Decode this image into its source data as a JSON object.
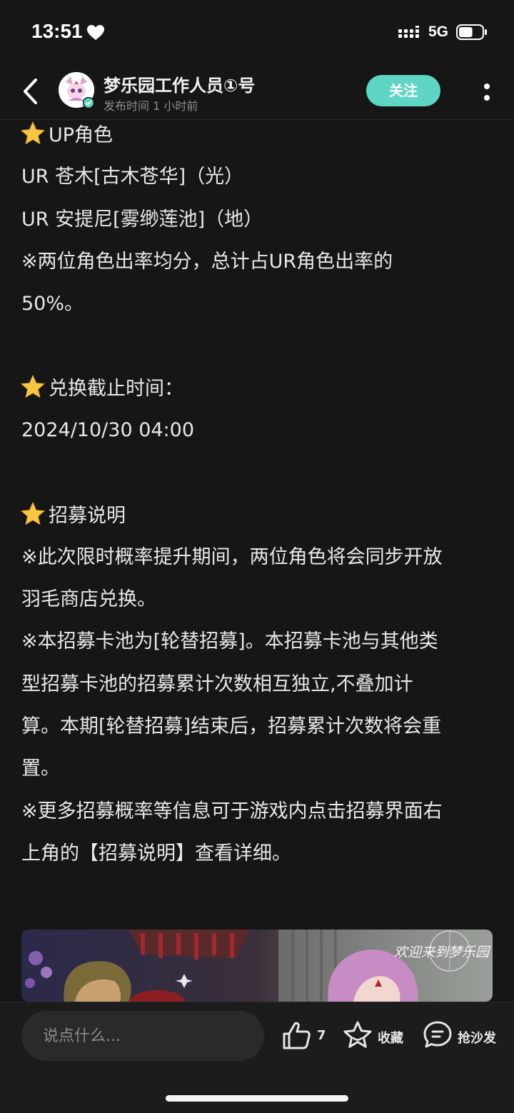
{
  "status_bar": {
    "time": "13:51",
    "network": "5G",
    "battery_level": 0.6
  },
  "header": {
    "author": "梦乐园工作人员①号",
    "publish_time": "发布时间 1 小时前",
    "follow_label": "关注"
  },
  "post": {
    "up_title": "UP角色",
    "up_line1": "UR 苍木[古木苍华]（光）",
    "up_line2": "UR 安提尼[雾缈莲池]（地）",
    "up_note_1": "※两位角色出率均分，总计占UR角色出率的",
    "up_note_2": "50%。",
    "exchange_title": "兑换截止时间：",
    "exchange_time": "2024/10/30  04:00",
    "recruit_title": "招募说明",
    "recruit_l1": "※此次限时概率提升期间，两位角色将会同步开放",
    "recruit_l2": "羽毛商店兑换。",
    "recruit_l3": "※本招募卡池为[轮替招募]。本招募卡池与其他类",
    "recruit_l4": "型招募卡池的招募累计次数相互独立,不叠加计",
    "recruit_l5": "算。本期[轮替招募]结束后，招募累计次数将会重",
    "recruit_l6": "置。",
    "recruit_l7": "※更多招募概率等信息可于游戏内点击招募界面右",
    "recruit_l8": "上角的【招募说明】查看详细。"
  },
  "banner": {
    "overlay_text": "欢迎来到梦乐园"
  },
  "bottom_bar": {
    "comment_placeholder": "说点什么...",
    "like_count": "7",
    "favorite_label": "收藏",
    "sofa_label": "抢沙发"
  },
  "colors": {
    "background": "#161616",
    "accent": "#5fd6c4",
    "star": "#f7c744"
  }
}
